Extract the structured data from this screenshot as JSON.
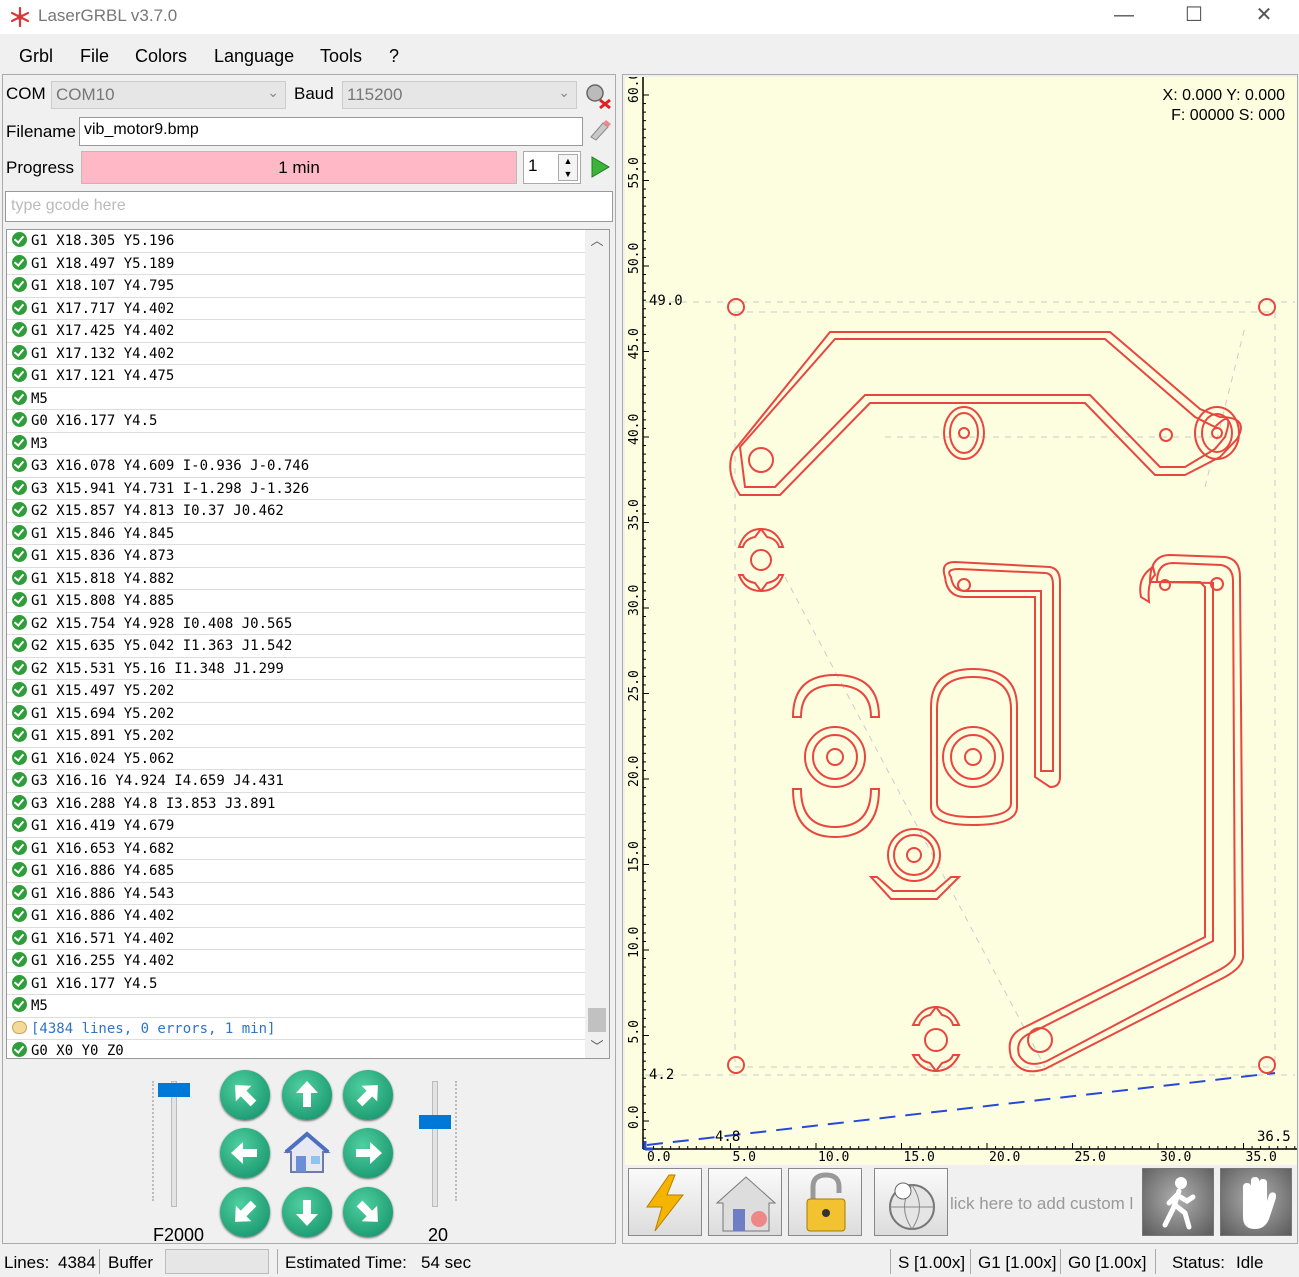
{
  "window": {
    "title": "LaserGRBL v3.7.0",
    "minimize": "—",
    "maximize": "☐",
    "close": "✕"
  },
  "menu": [
    "Grbl",
    "File",
    "Colors",
    "Language",
    "Tools",
    "?"
  ],
  "connection": {
    "com_label": "COM",
    "com_value": "COM10",
    "baud_label": "Baud",
    "baud_value": "115200"
  },
  "file": {
    "filename_label": "Filename",
    "filename_value": "vib_motor9.bmp"
  },
  "progress": {
    "label": "Progress",
    "text": "1 min",
    "copies": "1"
  },
  "gcode_input": {
    "placeholder": "type gcode here"
  },
  "log": [
    {
      "icon": "ok",
      "text": "G1 X18.305 Y5.196"
    },
    {
      "icon": "ok",
      "text": "G1 X18.497 Y5.189"
    },
    {
      "icon": "ok",
      "text": "G1 X18.107 Y4.795"
    },
    {
      "icon": "ok",
      "text": "G1 X17.717 Y4.402"
    },
    {
      "icon": "ok",
      "text": "G1 X17.425 Y4.402"
    },
    {
      "icon": "ok",
      "text": "G1 X17.132 Y4.402"
    },
    {
      "icon": "ok",
      "text": "G1 X17.121 Y4.475"
    },
    {
      "icon": "ok",
      "text": "M5"
    },
    {
      "icon": "ok",
      "text": "G0 X16.177 Y4.5"
    },
    {
      "icon": "ok",
      "text": "M3"
    },
    {
      "icon": "ok",
      "text": "G3 X16.078 Y4.609 I-0.936 J-0.746"
    },
    {
      "icon": "ok",
      "text": "G3 X15.941 Y4.731 I-1.298 J-1.326"
    },
    {
      "icon": "ok",
      "text": "G2 X15.857 Y4.813 I0.37 J0.462"
    },
    {
      "icon": "ok",
      "text": "G1 X15.846 Y4.845"
    },
    {
      "icon": "ok",
      "text": "G1 X15.836 Y4.873"
    },
    {
      "icon": "ok",
      "text": "G1 X15.818 Y4.882"
    },
    {
      "icon": "ok",
      "text": "G1 X15.808 Y4.885"
    },
    {
      "icon": "ok",
      "text": "G2 X15.754 Y4.928 I0.408 J0.565"
    },
    {
      "icon": "ok",
      "text": "G2 X15.635 Y5.042 I1.363 J1.542"
    },
    {
      "icon": "ok",
      "text": "G2 X15.531 Y5.16 I1.348 J1.299"
    },
    {
      "icon": "ok",
      "text": "G1 X15.497 Y5.202"
    },
    {
      "icon": "ok",
      "text": "G1 X15.694 Y5.202"
    },
    {
      "icon": "ok",
      "text": "G1 X15.891 Y5.202"
    },
    {
      "icon": "ok",
      "text": "G1 X16.024 Y5.062"
    },
    {
      "icon": "ok",
      "text": "G3 X16.16 Y4.924 I4.659 J4.431"
    },
    {
      "icon": "ok",
      "text": "G3 X16.288 Y4.8 I3.853 J3.891"
    },
    {
      "icon": "ok",
      "text": "G1 X16.419 Y4.679"
    },
    {
      "icon": "ok",
      "text": "G1 X16.653 Y4.682"
    },
    {
      "icon": "ok",
      "text": "G1 X16.886 Y4.685"
    },
    {
      "icon": "ok",
      "text": "G1 X16.886 Y4.543"
    },
    {
      "icon": "ok",
      "text": "G1 X16.886 Y4.402"
    },
    {
      "icon": "ok",
      "text": "G1 X16.571 Y4.402"
    },
    {
      "icon": "ok",
      "text": "G1 X16.255 Y4.402"
    },
    {
      "icon": "ok",
      "text": "G1 X16.177 Y4.5"
    },
    {
      "icon": "ok",
      "text": "M5"
    },
    {
      "icon": "info",
      "text": "[4384 lines, 0 errors, 1 min]"
    },
    {
      "icon": "ok",
      "text": "G0 X0 Y0 Z0"
    }
  ],
  "jog": {
    "feed_label": "F2000",
    "step_label": "20",
    "feed_level": 0.98,
    "step_level": 0.7
  },
  "preview": {
    "position": "X: 0.000 Y: 0.000",
    "feed_speed": "F: 00000 S: 000",
    "y_ruler": [
      "60.0",
      "55.0",
      "50.0",
      "45.0",
      "40.0",
      "35.0",
      "30.0",
      "25.0",
      "20.0",
      "15.0",
      "10.0",
      "5.0",
      "0.0"
    ],
    "x_ruler": [
      "0.0",
      "5.0",
      "10.0",
      "15.0",
      "20.0",
      "25.0",
      "30.0",
      "35.0"
    ],
    "bounds": {
      "ymax": "49.0",
      "ymin": "4.2",
      "xmin": "4.8",
      "xmax": "36.5"
    }
  },
  "toolbar": {
    "custom_placeholder": "lick here to add custom l"
  },
  "status": {
    "lines_label": "Lines:",
    "lines_value": "4384",
    "buffer_label": "Buffer",
    "est_label": "Estimated Time:",
    "est_value": "54 sec",
    "s_override": "S [1.00x]",
    "g1_override": "G1 [1.00x]",
    "g0_override": "G0 [1.00x]",
    "status_label": "Status:",
    "status_value": "Idle"
  },
  "colors": {
    "progress_fill": "#ffb8c6",
    "canvas_bg": "#fdfde0",
    "path": "#e8473f",
    "ok": "#2e9d3a",
    "accent": "#0078d7"
  }
}
